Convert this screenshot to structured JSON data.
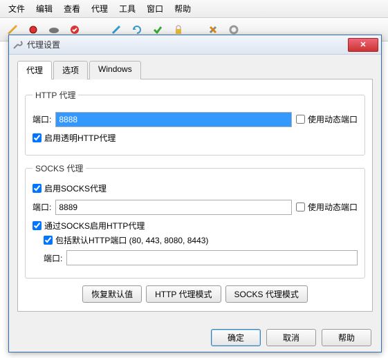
{
  "menubar": [
    "文件",
    "编辑",
    "查看",
    "代理",
    "工具",
    "窗口",
    "帮助"
  ],
  "toolbar_icons": [
    "broom-icon",
    "record-icon",
    "turtle-icon",
    "shield-icon",
    "pencil-icon",
    "refresh-icon",
    "check-icon",
    "lock-icon",
    "tool-icon",
    "gear-icon"
  ],
  "dialog": {
    "title": "代理设置",
    "tabs": [
      "代理",
      "选项",
      "Windows"
    ],
    "http": {
      "legend": "HTTP 代理",
      "port_label": "端口:",
      "port_value": "8888",
      "dyn_port_label": "使用动态端口",
      "dyn_port_checked": false,
      "transparent_label": "启用透明HTTP代理",
      "transparent_checked": true
    },
    "socks": {
      "legend": "SOCKS 代理",
      "enable_label": "启用SOCKS代理",
      "enable_checked": true,
      "port_label": "端口:",
      "port_value": "8889",
      "dyn_port_label": "使用动态端口",
      "dyn_port_checked": false,
      "http_over_label": "通过SOCKS启用HTTP代理",
      "http_over_checked": true,
      "include_label": "包括默认HTTP端口 (80, 443, 8080, 8443)",
      "include_checked": true,
      "port2_label": "端口:",
      "port2_value": ""
    },
    "buttons": {
      "restore": "恢复默认值",
      "http_mode": "HTTP 代理模式",
      "socks_mode": "SOCKS 代理模式",
      "ok": "确定",
      "cancel": "取消",
      "help": "帮助"
    }
  }
}
